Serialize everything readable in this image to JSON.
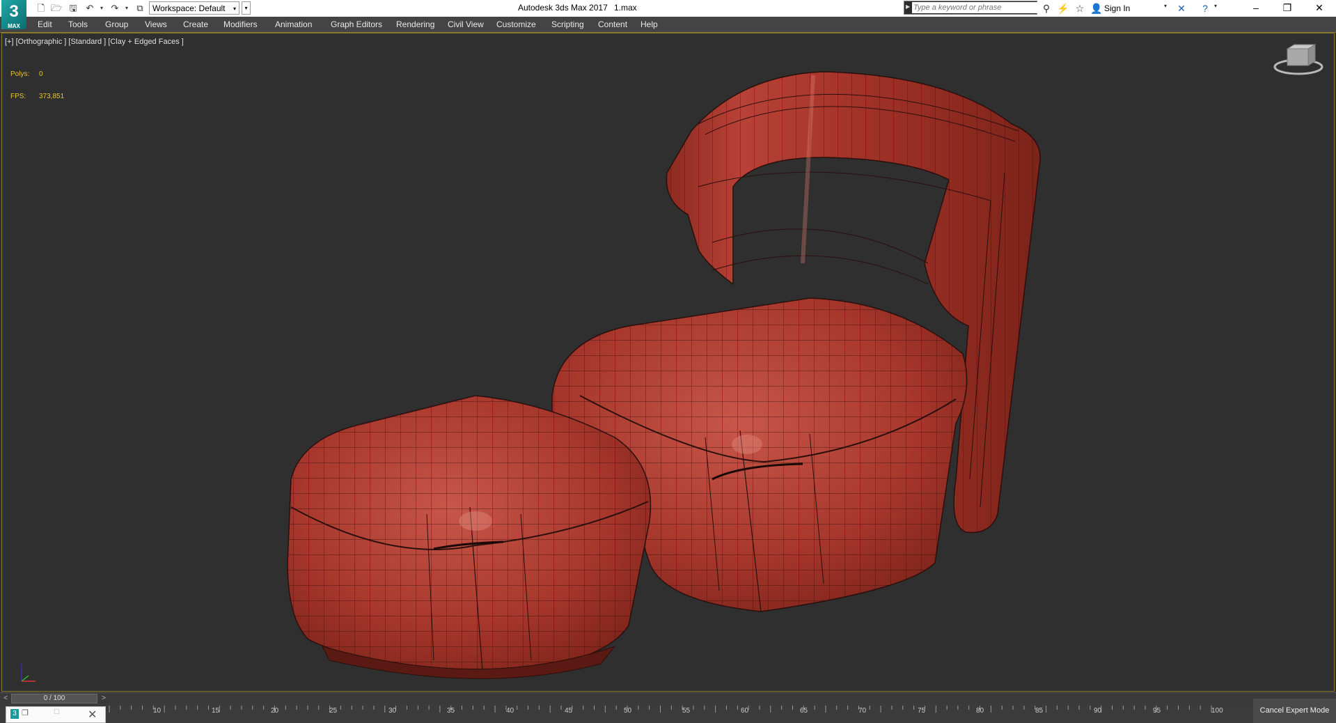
{
  "app": {
    "logo_text": "3",
    "logo_sub": "MAX",
    "title": "Autodesk 3ds Max 2017",
    "file": "1.max"
  },
  "quick_access": {
    "workspace_label": "Workspace: Default"
  },
  "search": {
    "placeholder": "Type a keyword or phrase"
  },
  "account": {
    "sign_in": "Sign In"
  },
  "menu": [
    "Edit",
    "Tools",
    "Group",
    "Views",
    "Create",
    "Modifiers",
    "Animation",
    "Graph Editors",
    "Rendering",
    "Civil View",
    "Customize",
    "Scripting",
    "Content",
    "Help"
  ],
  "viewport": {
    "label": "[+] [Orthographic ] [Standard ] [Clay + Edged Faces ]",
    "stats": [
      {
        "label": "Polys:",
        "value": "0"
      },
      {
        "label": "FPS:",
        "value": "373,851"
      }
    ],
    "mesh_color": "#b03a2e",
    "wire_color": "#2a0f0c"
  },
  "timeline": {
    "frame": "0 / 100",
    "ticks": [
      "10",
      "15",
      "20",
      "25",
      "30",
      "35",
      "40",
      "45",
      "50",
      "55",
      "60",
      "65",
      "70",
      "75",
      "80",
      "85",
      "90",
      "95",
      "100"
    ]
  },
  "status": {
    "expert_mode": "Cancel Expert Mode"
  },
  "icons": [
    "app-logo",
    "new-file-icon",
    "open-file-icon",
    "save-icon",
    "undo-icon",
    "redo-icon",
    "project-folder-icon",
    "binoculars-icon",
    "communication-icon",
    "star-icon",
    "user-icon",
    "exchange-icon",
    "help-icon",
    "minimize-icon",
    "restore-icon",
    "close-icon",
    "viewcube-icon",
    "axis-tripod-icon"
  ]
}
